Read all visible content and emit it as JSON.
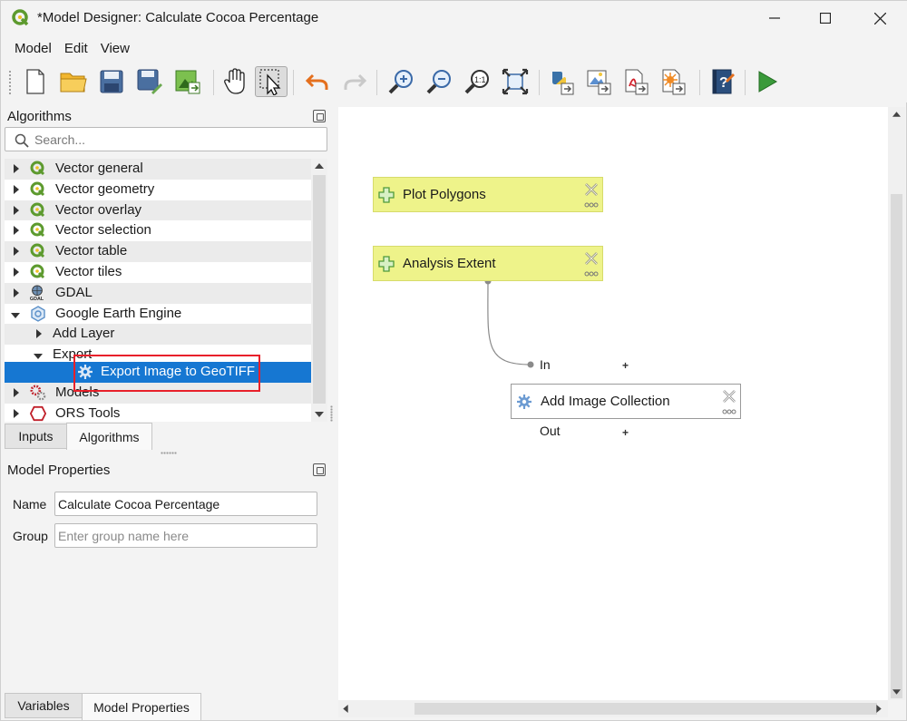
{
  "window": {
    "title": "*Model Designer: Calculate Cocoa Percentage"
  },
  "menu": {
    "items": [
      "Model",
      "Edit",
      "View"
    ]
  },
  "toolbar": {
    "buttons": [
      "new-model",
      "open-model",
      "save-model",
      "save-as",
      "export-image",
      "pan",
      "select",
      "undo",
      "redo",
      "zoom-in",
      "zoom-out",
      "zoom-actual",
      "zoom-full",
      "export-python",
      "export-image-file",
      "export-pdf",
      "export-svg",
      "help",
      "run"
    ]
  },
  "algorithms_panel": {
    "title": "Algorithms",
    "search_placeholder": "Search...",
    "tree": [
      {
        "label": "Vector general",
        "icon": "qgis-icon",
        "expanded": false
      },
      {
        "label": "Vector geometry",
        "icon": "qgis-icon",
        "expanded": false
      },
      {
        "label": "Vector overlay",
        "icon": "qgis-icon",
        "expanded": false
      },
      {
        "label": "Vector selection",
        "icon": "qgis-icon",
        "expanded": false
      },
      {
        "label": "Vector table",
        "icon": "qgis-icon",
        "expanded": false
      },
      {
        "label": "Vector tiles",
        "icon": "qgis-icon",
        "expanded": false
      },
      {
        "label": "GDAL",
        "icon": "gdal-icon",
        "expanded": false
      },
      {
        "label": "Google Earth Engine",
        "icon": "earth-engine-icon",
        "expanded": true
      },
      {
        "label": "Add Layer",
        "icon": "",
        "expanded": false
      },
      {
        "label": "Export",
        "icon": "",
        "expanded": true
      },
      {
        "label": "Export Image to GeoTIFF",
        "icon": "gear-icon",
        "selected": true
      },
      {
        "label": "Models",
        "icon": "models-icon",
        "expanded": false
      },
      {
        "label": "ORS Tools",
        "icon": "ors-icon",
        "expanded": false
      }
    ]
  },
  "upper_tabs": [
    "Inputs",
    "Algorithms"
  ],
  "model_properties": {
    "title": "Model Properties",
    "name_label": "Name",
    "name_value": "Calculate Cocoa Percentage",
    "group_label": "Group",
    "group_placeholder": "Enter group name here"
  },
  "lower_tabs": [
    "Variables",
    "Model Properties"
  ],
  "canvas": {
    "nodes": [
      {
        "label": "Plot Polygons",
        "kind": "input"
      },
      {
        "label": "Analysis Extent",
        "kind": "input"
      },
      {
        "label": "Add Image Collection",
        "kind": "algorithm"
      }
    ],
    "ports": {
      "in_label": "In",
      "out_label": "Out",
      "plus": "+"
    }
  },
  "colors": {
    "input_node": "#eef38a",
    "selection": "#1677d2",
    "highlight_box": "#e8202a",
    "run": "#3a9a3a"
  }
}
